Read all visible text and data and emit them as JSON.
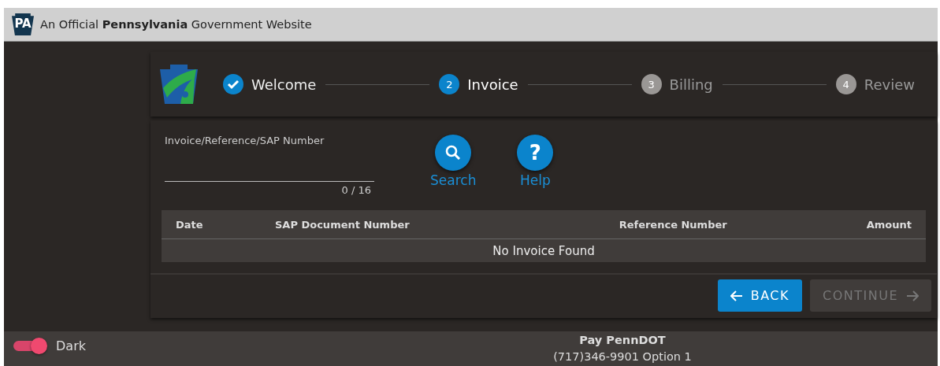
{
  "banner": {
    "badge": "PA",
    "text": "An Official **Pennsylvania** Government Website"
  },
  "steps": [
    {
      "kind": "complete",
      "label": "Welcome"
    },
    {
      "kind": "active",
      "number": "2",
      "label": "Invoice"
    },
    {
      "kind": "upcoming",
      "number": "3",
      "label": "Billing"
    },
    {
      "kind": "upcoming",
      "number": "4",
      "label": "Review"
    }
  ],
  "search_field": {
    "label": "Invoice/Reference/SAP Number",
    "counter": "0 / 16"
  },
  "actions": [
    {
      "kind": "search",
      "label": "Search"
    },
    {
      "kind": "help",
      "label": "Help",
      "icon": "?"
    }
  ],
  "table": {
    "columns": [
      "Date",
      "SAP Document Number",
      "Reference Number",
      "Amount"
    ],
    "empty_message": "No Invoice Found"
  },
  "buttons": [
    {
      "kind": "back",
      "label": "BACK",
      "disabled": false
    },
    {
      "kind": "continue",
      "label": "CONTINUE",
      "disabled": true
    }
  ],
  "footer": {
    "theme_toggle": {
      "label": "Dark",
      "on": true
    },
    "title": "Pay PennDOT",
    "phone": "(717)346-9901 Option 1"
  }
}
